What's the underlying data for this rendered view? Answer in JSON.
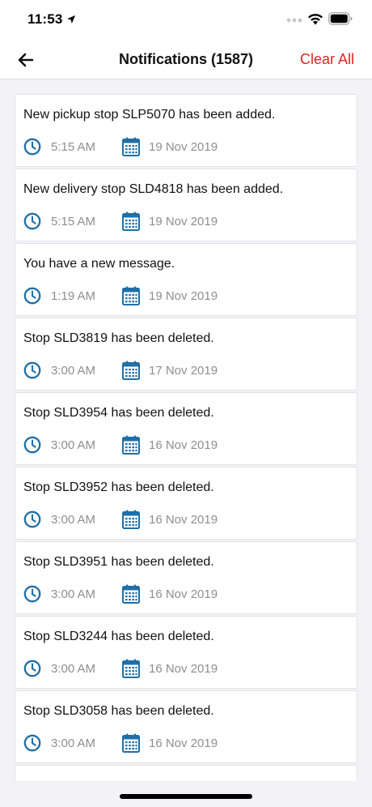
{
  "status_bar": {
    "time": "11:53"
  },
  "header": {
    "title": "Notifications (1587)",
    "clear_label": "Clear All"
  },
  "colors": {
    "accent_red": "#e02424",
    "icon_blue": "#1f6fa8",
    "muted_text": "#8e8e93"
  },
  "icons": {
    "back": "back-arrow-icon",
    "clock": "clock-icon",
    "calendar": "calendar-icon"
  },
  "notifications": [
    {
      "text": "New pickup stop SLP5070 has been added.",
      "time": "5:15 AM",
      "date": "19 Nov 2019"
    },
    {
      "text": "New delivery stop SLD4818 has been added.",
      "time": "5:15 AM",
      "date": "19 Nov 2019"
    },
    {
      "text": "You have a new message.",
      "time": "1:19 AM",
      "date": "19 Nov 2019"
    },
    {
      "text": "Stop SLD3819 has been deleted.",
      "time": "3:00 AM",
      "date": "17 Nov 2019"
    },
    {
      "text": "Stop SLD3954 has been deleted.",
      "time": "3:00 AM",
      "date": "16 Nov 2019"
    },
    {
      "text": "Stop SLD3952 has been deleted.",
      "time": "3:00 AM",
      "date": "16 Nov 2019"
    },
    {
      "text": "Stop SLD3951 has been deleted.",
      "time": "3:00 AM",
      "date": "16 Nov 2019"
    },
    {
      "text": "Stop SLD3244 has been deleted.",
      "time": "3:00 AM",
      "date": "16 Nov 2019"
    },
    {
      "text": "Stop SLD3058 has been deleted.",
      "time": "3:00 AM",
      "date": "16 Nov 2019"
    }
  ]
}
